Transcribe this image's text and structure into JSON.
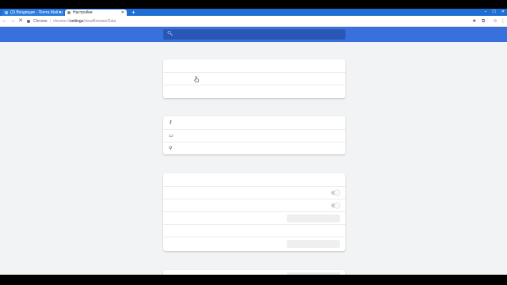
{
  "browser": {
    "tabs": [
      {
        "title": "(2) Входящие - Почта Mail.ru",
        "active": false
      },
      {
        "title": "Настройки",
        "active": true
      }
    ],
    "new_tab_label": "+",
    "window_controls": {
      "minimize": "–",
      "maximize": "☐",
      "close": "✕"
    },
    "address": {
      "site_label": "Chrome",
      "scheme": "chrome://",
      "host": "settings",
      "path": "/clearBrowserData"
    }
  },
  "settings": {
    "search_placeholder": ""
  },
  "icons": {
    "back": "back-arrow-icon",
    "forward": "forward-arrow-icon",
    "reload": "reload-icon",
    "bookmark": "star-icon",
    "search": "search-icon",
    "password": "key-icon",
    "payment": "credit-card-icon",
    "address": "location-pin-icon"
  },
  "colors": {
    "tabstrip": "#1e6fd3",
    "header": "#3871dd",
    "search_box": "#2857b6",
    "content_bg": "#f1f3f4",
    "card_bg": "#ffffff"
  }
}
